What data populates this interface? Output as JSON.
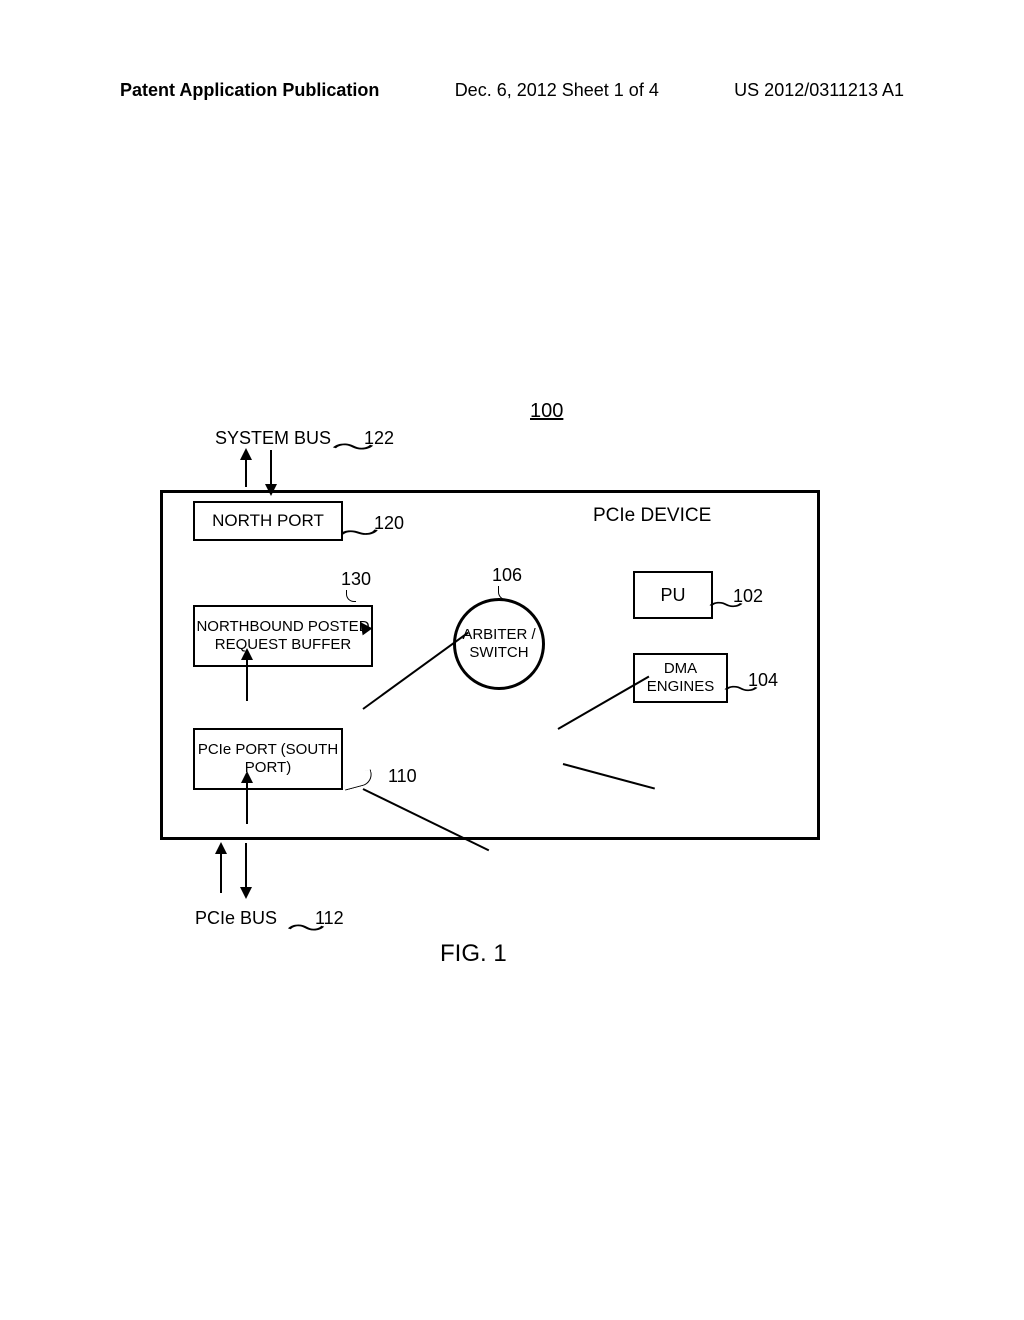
{
  "header": {
    "left": "Patent Application Publication",
    "center": "Dec. 6, 2012  Sheet 1 of 4",
    "right": "US 2012/0311213 A1"
  },
  "diagram": {
    "ref_100": "100",
    "system_bus_label": "SYSTEM BUS",
    "ref_122": "122",
    "device_title": "PCIe DEVICE",
    "north_port": "NORTH PORT",
    "ref_120": "120",
    "ref_130": "130",
    "northbound_buffer": "NORTHBOUND POSTED REQUEST BUFFER",
    "ref_106": "106",
    "arbiter": "ARBITER / SWITCH",
    "pu": "PU",
    "ref_102": "102",
    "dma": "DMA ENGINES",
    "ref_104": "104",
    "pcie_port": "PCIe PORT (SOUTH PORT)",
    "ref_110": "110",
    "pcie_bus_label": "PCIe BUS",
    "ref_112": "112",
    "fig_label": "FIG. 1"
  }
}
